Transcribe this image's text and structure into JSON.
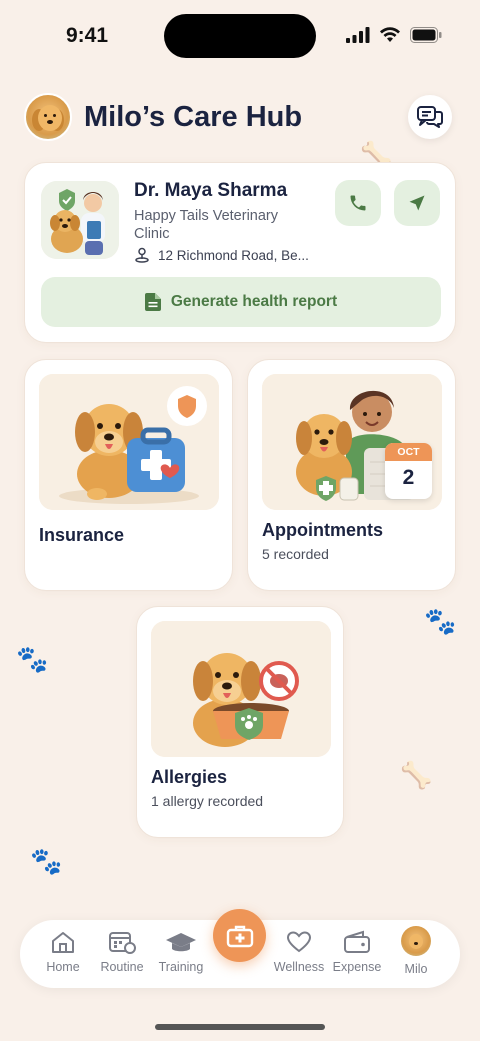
{
  "status_bar": {
    "time": "9:41"
  },
  "header": {
    "title": "Milo’s Care Hub",
    "avatar_icon": "dog-avatar",
    "chat_icon": "chat-bubbles-icon"
  },
  "vet": {
    "name": "Dr. Maya Sharma",
    "clinic": "Happy Tails Veterinary Clinic",
    "address": "12 Richmond Road, Be...",
    "call_icon": "phone-icon",
    "directions_icon": "navigation-icon",
    "report_label": "Generate health report"
  },
  "cards": {
    "insurance": {
      "title": "Insurance"
    },
    "appointments": {
      "title": "Appointments",
      "subtitle": "5 recorded",
      "calendar_month": "OCT",
      "calendar_day": "2"
    },
    "allergies": {
      "title": "Allergies",
      "subtitle": "1 allergy recorded"
    }
  },
  "tabs": [
    {
      "label": "Home",
      "icon": "home-icon"
    },
    {
      "label": "Routine",
      "icon": "calendar-clock-icon"
    },
    {
      "label": "Training",
      "icon": "graduation-cap-icon"
    },
    {
      "label": "Wellness",
      "icon": "heart-icon"
    },
    {
      "label": "Expense",
      "icon": "wallet-icon"
    },
    {
      "label": "Milo",
      "icon": "dog-avatar"
    }
  ],
  "colors": {
    "accent": "#ee9557",
    "green": "#4b7a45",
    "green_bg": "#e4f0e0",
    "navy": "#1b2340",
    "background": "#f9f0e9"
  }
}
